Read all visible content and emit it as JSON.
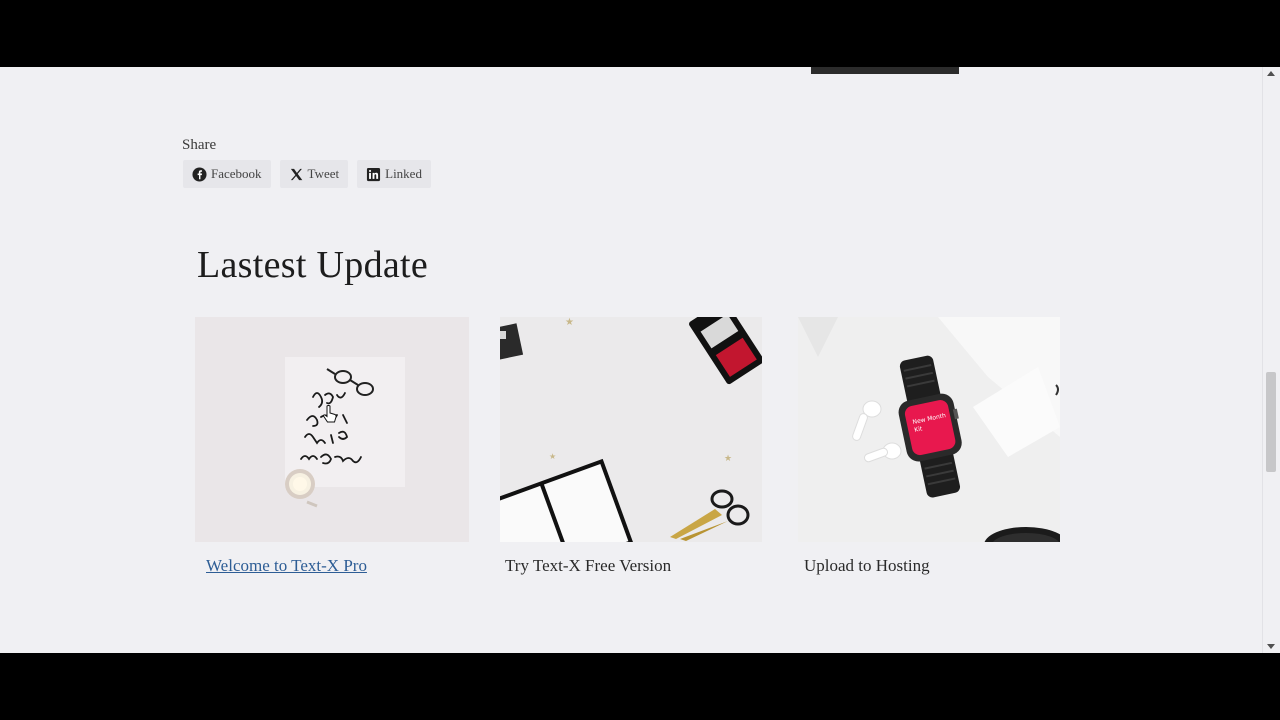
{
  "share": {
    "label": "Share",
    "buttons": [
      {
        "label": "Facebook",
        "icon": "facebook-icon"
      },
      {
        "label": "Tweet",
        "icon": "x-icon"
      },
      {
        "label": "Linked",
        "icon": "linkedin-icon"
      }
    ]
  },
  "latest": {
    "title": "Lastest Update",
    "posts": [
      {
        "title": "Welcome to Text-X Pro",
        "image": "notebook-flatlay-image"
      },
      {
        "title": "Try Text-X Free Version",
        "image": "desk-flatlay-image"
      },
      {
        "title": "Upload to Hosting",
        "image": "smartwatch-flatlay-image"
      }
    ]
  },
  "colors": {
    "page_background": "#f0f0f3",
    "link": "#2d5d95",
    "heading": "#1d1d1d"
  }
}
